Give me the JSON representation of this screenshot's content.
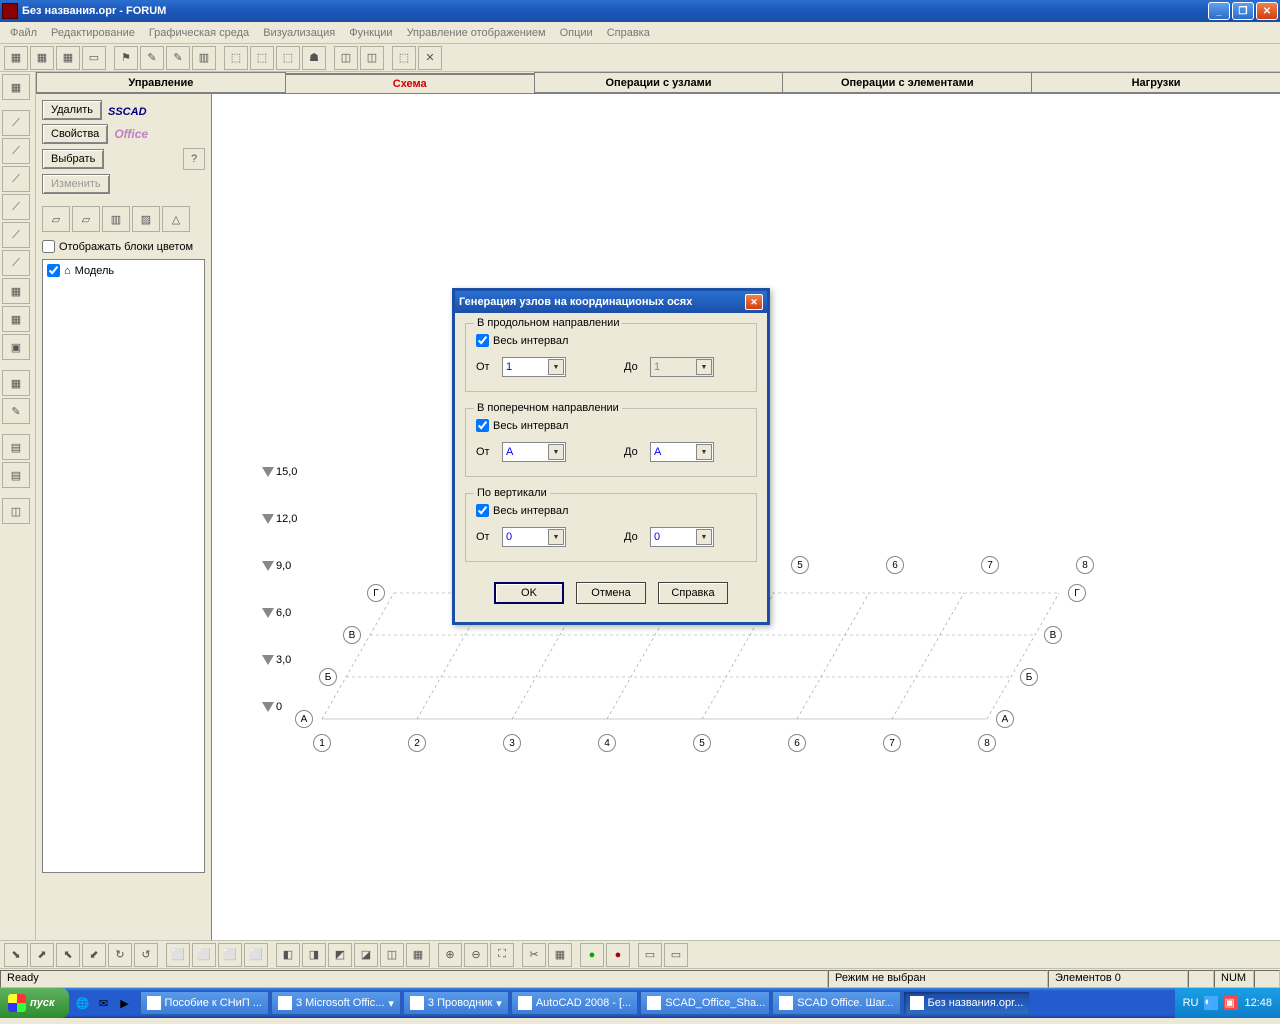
{
  "titlebar": {
    "title": "Без названия.opr - FORUM"
  },
  "menubar": {
    "items": [
      "Файл",
      "Редактирование",
      "Графическая среда",
      "Визуализация",
      "Функции",
      "Управление отображением",
      "Опции",
      "Справка"
    ]
  },
  "tabs": {
    "items": [
      "Управление",
      "Схема",
      "Операции с узлами",
      "Операции с элементами",
      "Нагрузки"
    ],
    "active": 1
  },
  "side": {
    "delete": "Удалить",
    "props": "Свойства",
    "select": "Выбрать",
    "modify": "Изменить",
    "logo_top": "SCAD",
    "logo_bottom": "Office",
    "show_blocks": "Отображать блоки цветом",
    "tree_root": "Модель"
  },
  "canvas": {
    "z_levels": [
      "15,0",
      "12,0",
      "9,0",
      "6,0",
      "3,0",
      "0"
    ],
    "y_axes": [
      "Г",
      "В",
      "Б",
      "А"
    ],
    "x_axes": [
      "1",
      "2",
      "3",
      "4",
      "5",
      "6",
      "7",
      "8"
    ],
    "top_axes": [
      "5",
      "6",
      "7",
      "8"
    ]
  },
  "dialog": {
    "title": "Генерация узлов на координационых осях",
    "g1": {
      "legend": "В продольном направлении",
      "chk": "Весь интервал",
      "from_lbl": "От",
      "from_val": "1",
      "to_lbl": "До",
      "to_val": "1"
    },
    "g2": {
      "legend": "В поперечном направлении",
      "chk": "Весь интервал",
      "from_lbl": "От",
      "from_val": "А",
      "to_lbl": "До",
      "to_val": "А"
    },
    "g3": {
      "legend": "По вертикали",
      "chk": "Весь интервал",
      "from_lbl": "От",
      "from_val": "0",
      "to_lbl": "До",
      "to_val": "0"
    },
    "ok": "OK",
    "cancel": "Отмена",
    "help": "Справка"
  },
  "statusbar": {
    "ready": "Ready",
    "mode": "Режим не выбран",
    "elements": "Элементов 0",
    "num": "NUM"
  },
  "taskbar": {
    "start": "пуск",
    "items": [
      "Пособие к СНиП ...",
      "3 Microsoft Offic...",
      "3 Проводник",
      "AutoCAD 2008 - [...",
      "SCAD_Office_Sha...",
      "SCAD Office. Шаг...",
      "Без названия.opr..."
    ],
    "active": 6,
    "lang": "RU",
    "clock": "12:48"
  }
}
